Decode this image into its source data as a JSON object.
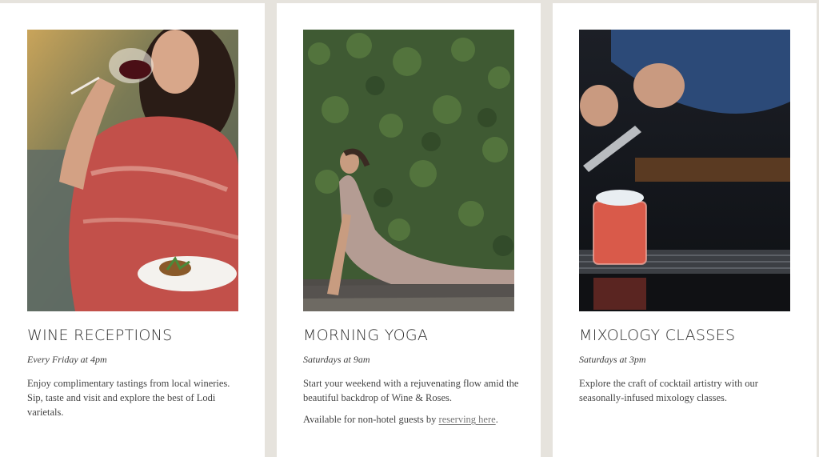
{
  "cards": [
    {
      "title": "WINE RECEPTIONS",
      "when": "Every Friday at 4pm",
      "description": "Enjoy complimentary tastings from local wineries. Sip, taste and visit and explore the best of Lodi varietals."
    },
    {
      "title": "MORNING YOGA",
      "when": "Saturdays at 9am",
      "description": "Start your weekend with a rejuvenating flow amid the beautiful backdrop of Wine & Roses.",
      "note_prefix": "Available for non-hotel guests by ",
      "note_link": "reserving here",
      "note_suffix": "."
    },
    {
      "title": "MIXOLOGY CLASSES",
      "when": "Saturdays at 3pm",
      "description": "Explore the craft of cocktail artistry with our seasonally-infused mixology classes."
    }
  ],
  "colors": {
    "page_background": "#e6e3dd",
    "card_background": "#ffffff",
    "heading_text": "#2f2f2f",
    "body_text": "#444444"
  }
}
